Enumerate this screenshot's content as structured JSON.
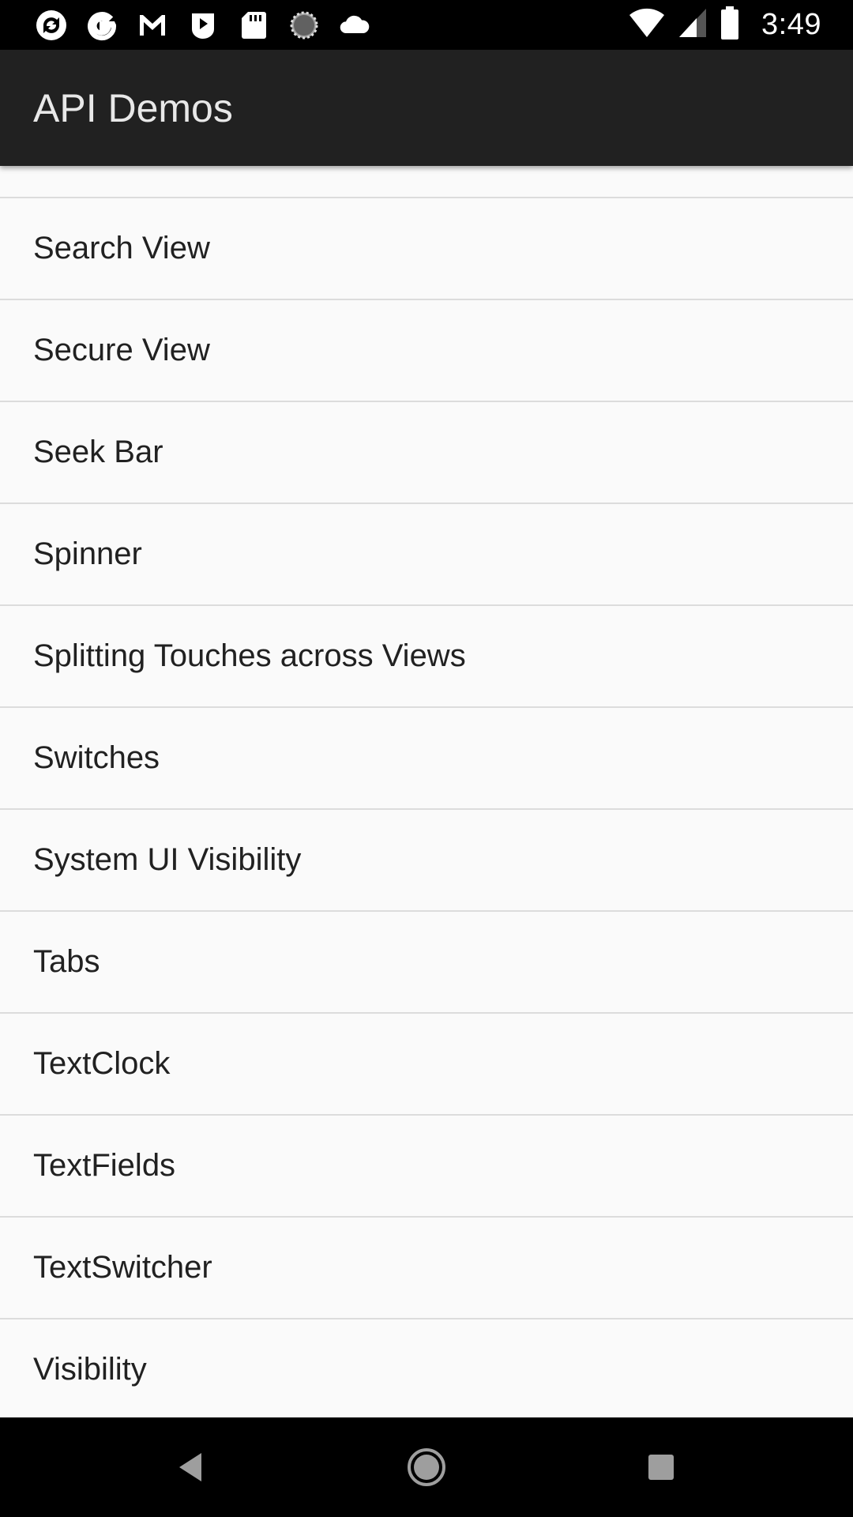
{
  "status_bar": {
    "time": "3:49",
    "left_icons": [
      "sync-icon",
      "google-icon",
      "gmail-icon",
      "play-store-icon",
      "sd-card-icon",
      "loading-icon",
      "cloud-icon"
    ],
    "right_icons": [
      "wifi-icon",
      "signal-icon",
      "battery-icon"
    ]
  },
  "app_bar": {
    "title": "API Demos"
  },
  "list": {
    "items": [
      {
        "label": "Search View"
      },
      {
        "label": "Secure View"
      },
      {
        "label": "Seek Bar"
      },
      {
        "label": "Spinner"
      },
      {
        "label": "Splitting Touches across Views"
      },
      {
        "label": "Switches"
      },
      {
        "label": "System UI Visibility"
      },
      {
        "label": "Tabs"
      },
      {
        "label": "TextClock"
      },
      {
        "label": "TextFields"
      },
      {
        "label": "TextSwitcher"
      },
      {
        "label": "Visibility"
      }
    ]
  },
  "nav_bar": {
    "buttons": [
      "back-icon",
      "home-icon",
      "recents-icon"
    ]
  },
  "colors": {
    "status_bar": "#000000",
    "app_bar": "#212121",
    "list_background": "#fafafa",
    "divider": "#dcdcdc",
    "text": "#212121"
  }
}
